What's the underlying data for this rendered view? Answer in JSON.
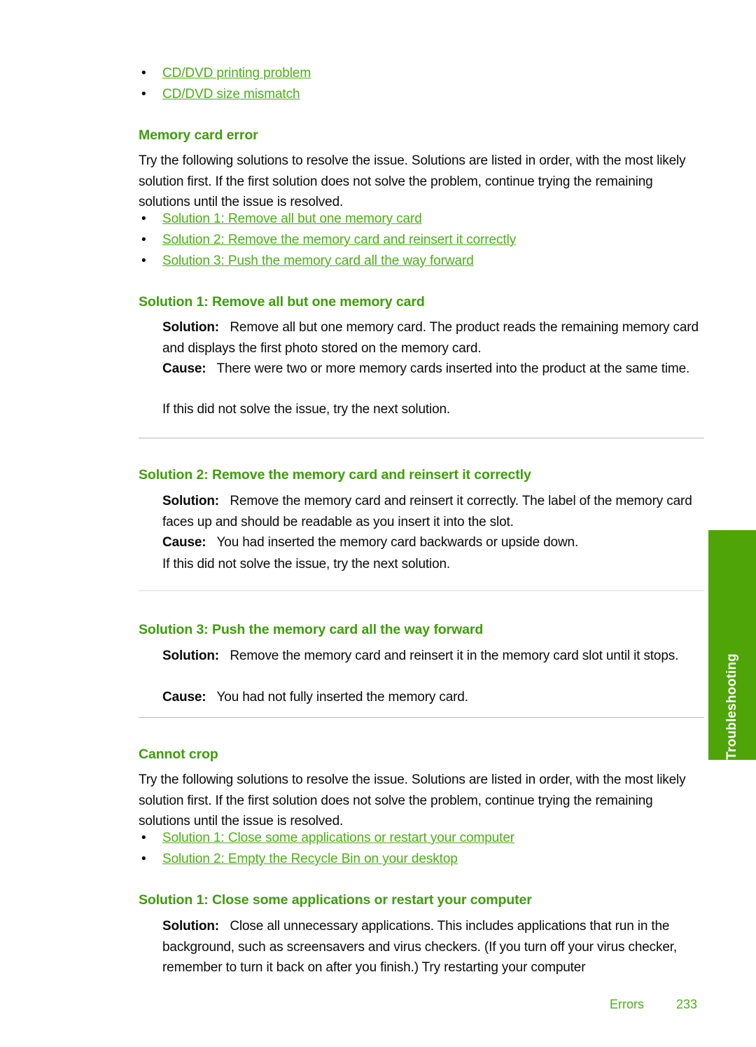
{
  "page": {
    "footer_section": "Errors",
    "page_number": "233",
    "side_tab_label": "Troubleshooting",
    "heading_color": "#3f9c0c",
    "link_color": "#4caf16",
    "tab_color": "#4fa507",
    "rule_color": "#b9b9b9"
  },
  "top_links": [
    {
      "text": "CD/DVD printing problem"
    },
    {
      "text": "CD/DVD size mismatch"
    }
  ],
  "sections": [
    {
      "id": "memory-card-error",
      "heading": "Memory card error",
      "intro": "Try the following solutions to resolve the issue. Solutions are listed in order, with the most likely solution first. If the first solution does not solve the problem, continue trying the remaining solutions until the issue is resolved.",
      "links": [
        {
          "text": "Solution 1: Remove all but one memory card"
        },
        {
          "text": "Solution 2: Remove the memory card and reinsert it correctly"
        },
        {
          "text": "Solution 3: Push the memory card all the way forward"
        }
      ]
    },
    {
      "id": "cannot-crop",
      "heading": "Cannot crop",
      "intro": "Try the following solutions to resolve the issue. Solutions are listed in order, with the most likely solution first. If the first solution does not solve the problem, continue trying the remaining solutions until the issue is resolved.",
      "links": [
        {
          "text": "Solution 1: Close some applications or restart your computer"
        },
        {
          "text": "Solution 2: Empty the Recycle Bin on your desktop"
        }
      ]
    }
  ],
  "solutions": [
    {
      "id": "sol-1-remove-all-but-one",
      "heading": "Solution 1: Remove all but one memory card",
      "solution_label": "Solution:",
      "solution_text": "Remove all but one memory card. The product reads the remaining memory card and displays the first photo stored on the memory card.",
      "cause_label": "Cause:",
      "cause_text": "There were two or more memory cards inserted into the product at the same time.",
      "next_text": "If this did not solve the issue, try the next solution."
    },
    {
      "id": "sol-2-reinsert-correctly",
      "heading": "Solution 2: Remove the memory card and reinsert it correctly",
      "solution_label": "Solution:",
      "solution_text": "Remove the memory card and reinsert it correctly. The label of the memory card faces up and should be readable as you insert it into the slot.",
      "cause_label": "Cause:",
      "cause_text": "You had inserted the memory card backwards or upside down.",
      "next_text": "If this did not solve the issue, try the next solution."
    },
    {
      "id": "sol-3-push-all-the-way",
      "heading": "Solution 3: Push the memory card all the way forward",
      "solution_label": "Solution:",
      "solution_text": "Remove the memory card and reinsert it in the memory card slot until it stops.",
      "cause_label": "Cause:",
      "cause_text": "You had not fully inserted the memory card.",
      "next_text": ""
    },
    {
      "id": "sol-1-close-applications",
      "heading": "Solution 1: Close some applications or restart your computer",
      "solution_label": "Solution:",
      "solution_text": "Close all unnecessary applications. This includes applications that run in the background, such as screensavers and virus checkers. (If you turn off your virus checker, remember to turn it back on after you finish.) Try restarting your computer",
      "cause_label": "",
      "cause_text": "",
      "next_text": ""
    }
  ]
}
